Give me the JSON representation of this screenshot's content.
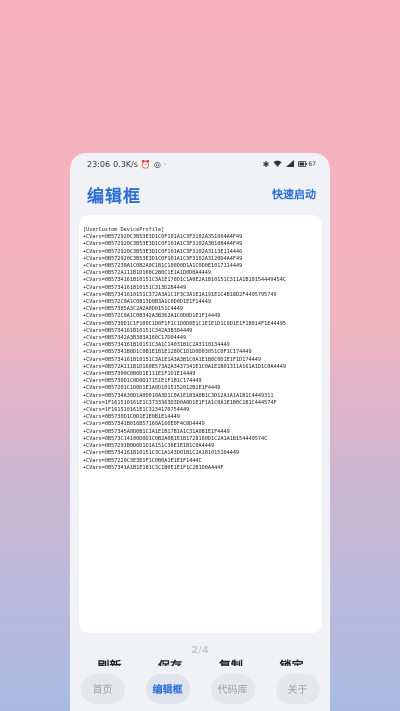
{
  "status": {
    "time": "23:06",
    "speed": "0.3K/s",
    "icons_left": [
      "alarm-icon",
      "sync-icon",
      "dot"
    ],
    "icons_right": [
      "bluetooth-icon",
      "wifi-icon",
      "signal-icon",
      "battery-icon"
    ],
    "battery": "67"
  },
  "app": {
    "title": "编辑框",
    "quick_launch": "快速启动"
  },
  "editor": {
    "content": "[UserCustom DeviceProfile]\n+CVars=0B572920C3B53E3D1C0F101A1C3F3102A351004A4F49\n+CVars=0B572920C3B53E3D1C0F101A1C3F3102A3B10B4A4F49\n+CVars=0B572920C3B53E3D1C0F101A1C3F3102A3113E114446\n+CVars=0B572920C3B53E3D1C0F101A1C3F3102A3120D4A4F49\n+CVars=0B57230A1C0B2A0C1B1C100D0D1A1C0D0E1017114449\n+CVars=0B572A111B1D160C2B0C1E1A1D0D0A4449\n+CVars=0B5734161B10151C3A1E170D1C1A0E2A1B10151C311A1B10154449454C\n+CVars=0B5734161B10151C313D2B4449\n+CVars=0B57341610151C372A3A1C1F3C3A1E1A191E1C4B18D2F4495795749\n+CVars=0B572C0A1C0B13D0B3A1C0D0D1E1F14449\n+CVars=0B57385A3C2A2A0D0151C4449\n+CVars=0B572C0A1C0B342A3B362A1C0D0D1E1F14449\n+CVars=0B5730D1C1F100C1D0F1F1C1D0D0E1C1E1E1D1C0D1E1F1B014F1E44495\n+CVars=0B5734161B10151C342A3B384449\n+CVars=0B57342A3B383A160C17D04449\n+CVars=0B5734161B10151C3A1C14031B1C2A3110134449\n+CVars=0B57341B0D1C0B1E1B1E1280C1D1D0D03051C0F1C174449\n+CVars=0B5734161B10151C3A1E1A3A3B1C0A1E1B0C0D1E1F1D174449\n+CVars=0B572A111B1D160E573A2A3437341E1C0A1E1B01311A161A1D1C0A4449\n+CVars=0B57300C0B0D1E111E1F1D1E14449\n+CVars=0B5730D1C0D0D17151E1F1B1C174449\n+CVars=0B57201C1D0D1E1A0D1015152012B1E1F4449\n+CVars=0B5734A30D1A0D010A3D1C0A1E1B3A0B1C3D12A1A1A1B1C4449311\n+CVars=1F161510161E1C3733363D3D0A0D1E1F1A1C0A1E1B0C1B1C444574F\n+CVars=1F161510161E1C3234170754449\n+CVars=0B5730D1C0D1E1E0B1E14449\n+CVars=0B57341B016B57160A160E0F4C0D4449\n+CVars=0B57345A0D0B1C1A1E1B17B1A1C31A0B1E1F4449\n+CVars=0B573C14100D0D1C0B2A0B1E1B1728160D1C2A1A1B154449574C\n+CVars=0B57291B0D0D1D1A151C36E1E1B1C0A4449\n+CVars=0B5734161B10151C3C1A143D01B1C2A1B1015104449\n+CVars=0B57220C3E3E1F1C0B0A1E1E1F1444C\n+CVars=0B57341A1B1E1B1C3C1B0E1E1F1C2B1D0A444F"
  },
  "actions": {
    "refresh": "刷新",
    "save": "保存",
    "copy": "复制",
    "lock": "锁定"
  },
  "pager": "2/4",
  "nav": {
    "home": "首页",
    "editor": "编辑框",
    "library": "代码库",
    "about": "关于"
  },
  "colors": {
    "accent": "#2b6fd6",
    "background_top": "#f6b3bd",
    "background_bottom": "#a9bbe3"
  }
}
